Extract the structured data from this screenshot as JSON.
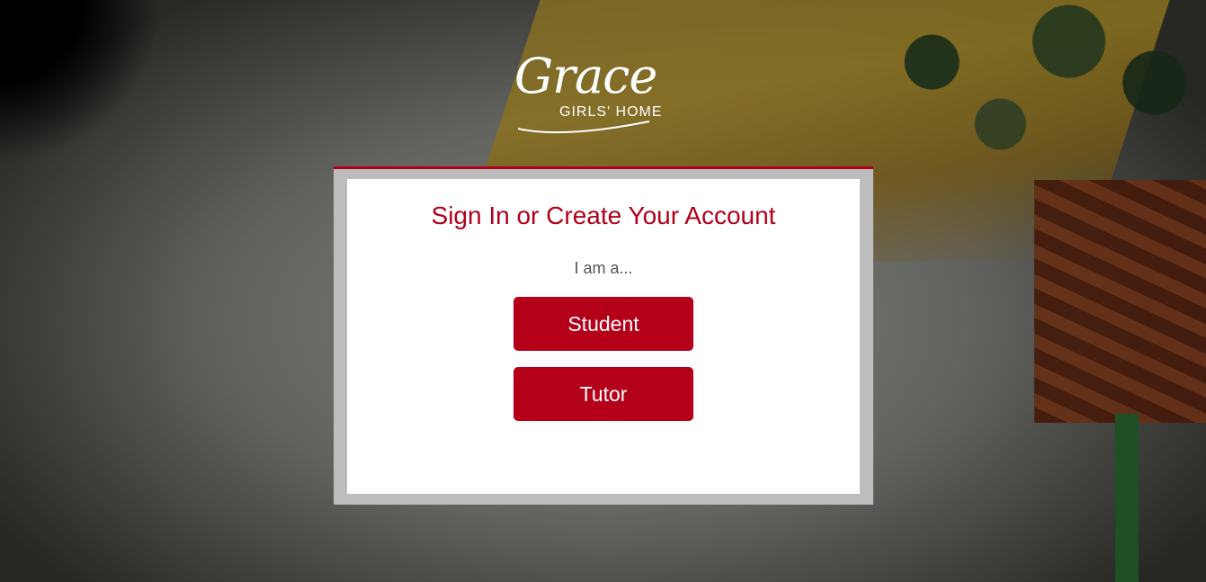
{
  "logo": {
    "script": "Grace",
    "subtitle": "GIRLS' HOME"
  },
  "modal": {
    "title": "Sign In or Create Your Account",
    "prompt": "I am a...",
    "buttons": {
      "student": "Student",
      "tutor": "Tutor"
    }
  },
  "colors": {
    "accent": "#b0001a",
    "button": "#b5001a",
    "frame": "#bdbdbd"
  }
}
